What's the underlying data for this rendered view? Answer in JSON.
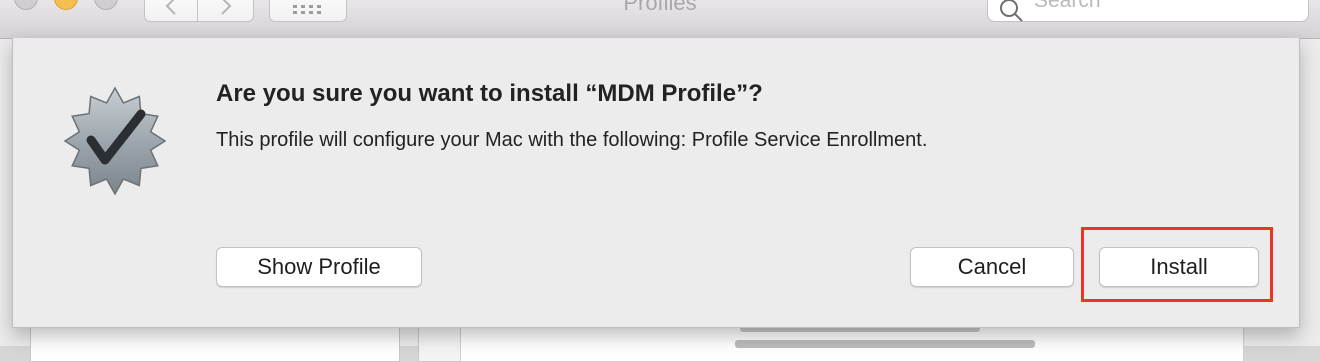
{
  "window": {
    "title": "Profiles",
    "search_placeholder": "Search"
  },
  "toolbar": {
    "back_icon": "chevron-left-icon",
    "forward_icon": "chevron-right-icon",
    "grid_icon": "grid-icon"
  },
  "dialog": {
    "icon": "verified-badge-checkmark-icon",
    "heading": "Are you sure you want to install “MDM Profile”?",
    "message": "This profile will configure your Mac with the following: Profile Service Enrollment.",
    "buttons": {
      "show_profile": "Show Profile",
      "cancel": "Cancel",
      "install": "Install"
    },
    "highlight_color": "#ee3524"
  }
}
